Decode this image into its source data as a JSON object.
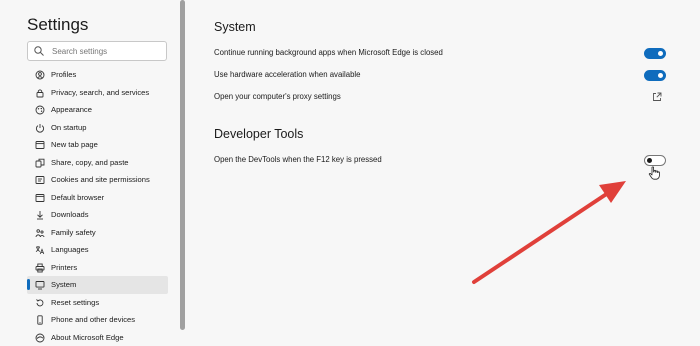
{
  "sidebar": {
    "title": "Settings",
    "search_placeholder": "Search settings",
    "items": [
      {
        "label": "Profiles",
        "icon": "profile-icon"
      },
      {
        "label": "Privacy, search, and services",
        "icon": "lock-icon"
      },
      {
        "label": "Appearance",
        "icon": "appearance-icon"
      },
      {
        "label": "On startup",
        "icon": "power-icon"
      },
      {
        "label": "New tab page",
        "icon": "new-tab-icon"
      },
      {
        "label": "Share, copy, and paste",
        "icon": "share-icon"
      },
      {
        "label": "Cookies and site permissions",
        "icon": "cookies-icon"
      },
      {
        "label": "Default browser",
        "icon": "browser-icon"
      },
      {
        "label": "Downloads",
        "icon": "download-icon"
      },
      {
        "label": "Family safety",
        "icon": "family-icon"
      },
      {
        "label": "Languages",
        "icon": "languages-icon"
      },
      {
        "label": "Printers",
        "icon": "printer-icon"
      },
      {
        "label": "System",
        "icon": "system-icon",
        "active": true
      },
      {
        "label": "Reset settings",
        "icon": "reset-icon"
      },
      {
        "label": "Phone and other devices",
        "icon": "phone-icon"
      },
      {
        "label": "About Microsoft Edge",
        "icon": "edge-icon"
      }
    ]
  },
  "system": {
    "title": "System",
    "rows": [
      {
        "label": "Continue running background apps when Microsoft Edge is closed",
        "control": "toggle",
        "state": "on"
      },
      {
        "label": "Use hardware acceleration when available",
        "control": "toggle",
        "state": "on"
      },
      {
        "label": "Open your computer's proxy settings",
        "control": "external-link-icon"
      }
    ]
  },
  "developer_tools": {
    "title": "Developer Tools",
    "rows": [
      {
        "label": "Open the DevTools when the F12 key is pressed",
        "control": "toggle",
        "state": "off"
      }
    ]
  },
  "colors": {
    "accent": "#0f6cbd",
    "annotation_arrow": "#e0403a",
    "background": "#f7f7f7"
  }
}
